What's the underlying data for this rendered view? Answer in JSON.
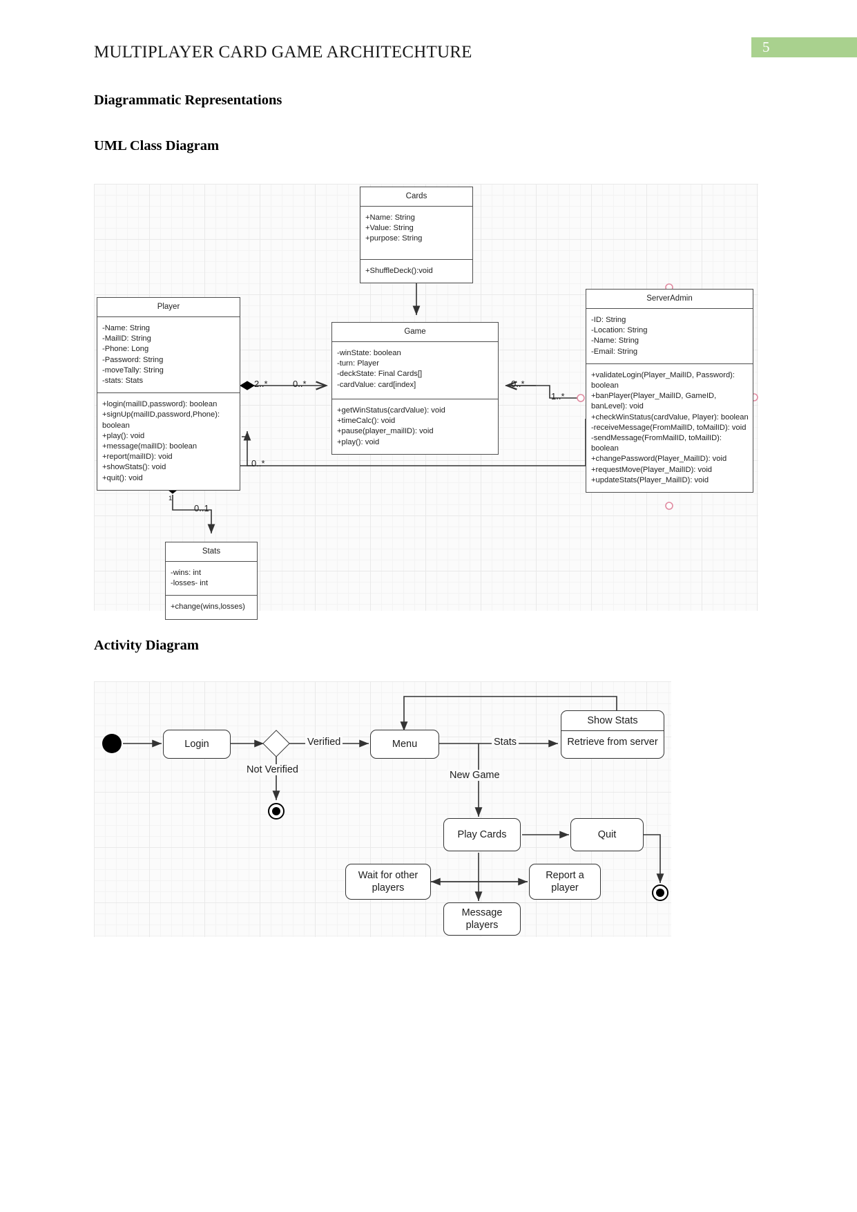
{
  "header": {
    "title": "MULTIPLAYER CARD GAME ARCHITECHTURE",
    "page_number": "5",
    "band_color": "#a9d18e"
  },
  "headings": {
    "diagrammatic": "Diagrammatic Representations",
    "uml": "UML Class Diagram",
    "activity": "Activity Diagram"
  },
  "uml_diagram": {
    "classes": {
      "cards": {
        "name": "Cards",
        "attributes": [
          "+Name: String",
          "+Value: String",
          "+purpose: String"
        ],
        "methods": [
          "+ShuffleDeck():void"
        ]
      },
      "player": {
        "name": "Player",
        "attributes": [
          "-Name: String",
          "-MailID: String",
          "-Phone: Long",
          "-Password: String",
          "-moveTally: String",
          "-stats: Stats"
        ],
        "methods": [
          "+login(mailID,password): boolean",
          "+signUp(mailID,password,Phone): boolean",
          "+play(): void",
          "+message(mailID): boolean",
          "+report(mailID): void",
          "+showStats(): void",
          "+quit(): void"
        ]
      },
      "game": {
        "name": "Game",
        "attributes": [
          "-winState: boolean",
          "-turn: Player",
          "-deckState: Final Cards[]",
          "-cardValue: card[index]"
        ],
        "methods": [
          "+getWinStatus(cardValue): void",
          "+timeCalc(): void",
          "+pause(player_mailID): void",
          "+play(): void"
        ]
      },
      "serveradmin": {
        "name": "ServerAdmin",
        "attributes": [
          "-ID: String",
          "-Location: String",
          "-Name: String",
          "-Email: String"
        ],
        "methods": [
          "+validateLogin(Player_MailID, Password): boolean",
          "+banPlayer(Player_MailID, GameID, banLevel): void",
          "+checkWinStatus(cardValue, Player): boolean",
          "-receiveMessage(FromMailID, toMailID): void",
          "-sendMessage(FromMailID, toMailID): boolean",
          "+changePassword(Player_MailID): void",
          "+requestMove(Player_MailID): void",
          "+updateStats(Player_MailID): void"
        ]
      },
      "stats": {
        "name": "Stats",
        "attributes": [
          "-wins: int",
          "-losses- int"
        ],
        "methods": [
          "+change(wins,losses)"
        ]
      }
    },
    "multiplicities": {
      "player_game_left": "2..*",
      "player_game_right": "0..*",
      "game_server_left": "0..*",
      "game_server_right": "1..*",
      "player_server_lower": "0..*",
      "player_stats_one": "1",
      "player_stats_zero_one": "0..1"
    }
  },
  "activity_diagram": {
    "nodes": {
      "login": "Login",
      "menu": "Menu",
      "show_stats_title": "Show Stats",
      "show_stats_body": "Retrieve from server",
      "play_cards": "Play Cards",
      "quit": "Quit",
      "wait": "Wait for other players",
      "report": "Report a player",
      "message": "Message players"
    },
    "edge_labels": {
      "verified": "Verified",
      "not_verified": "Not Verified",
      "stats": "Stats",
      "new_game": "New Game"
    }
  }
}
